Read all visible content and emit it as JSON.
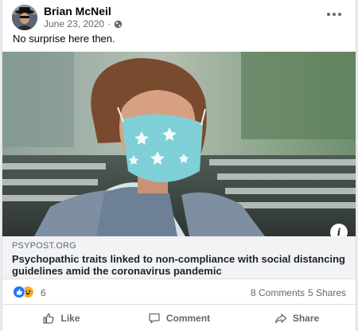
{
  "post": {
    "author": "Brian McNeil",
    "date": "June 23, 2020",
    "separator": "·",
    "privacy_icon": "globe-icon",
    "text": "No surprise here then."
  },
  "link": {
    "domain": "PSYPOST.ORG",
    "title": "Psychopathic traits linked to non-compliance with social distancing guidelines amid the coronavirus pandemic",
    "info_icon": "info-icon",
    "info_glyph": "i"
  },
  "engagement": {
    "reaction_icons": [
      "like-reaction-icon",
      "haha-reaction-icon"
    ],
    "reaction_count": "6",
    "comments": "8 Comments",
    "shares": "5 Shares"
  },
  "actions": {
    "like_label": "Like",
    "comment_label": "Comment",
    "share_label": "Share"
  },
  "colors": {
    "page_background": "#e9ebee",
    "card_background": "#ffffff",
    "link_background": "#f2f3f5",
    "secondary_text": "#65676b",
    "like_blue": "#2078f4",
    "haha_yellow": "#f7b125"
  }
}
